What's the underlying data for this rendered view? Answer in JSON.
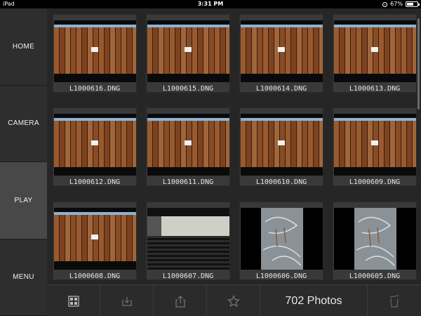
{
  "status_bar": {
    "device": "iPad",
    "time": "3:31 PM",
    "battery": "67%",
    "battery_level": 0.67
  },
  "nav": {
    "items": [
      {
        "label": "HOME",
        "active": false
      },
      {
        "label": "CAMERA",
        "active": false
      },
      {
        "label": "PLAY",
        "active": true
      },
      {
        "label": "MENU",
        "active": false
      }
    ]
  },
  "photos": [
    {
      "name": "L1000616.DNG",
      "kind": "fence"
    },
    {
      "name": "L1000615.DNG",
      "kind": "fence"
    },
    {
      "name": "L1000614.DNG",
      "kind": "fence"
    },
    {
      "name": "L1000613.DNG",
      "kind": "fence"
    },
    {
      "name": "L1000612.DNG",
      "kind": "fence"
    },
    {
      "name": "L1000611.DNG",
      "kind": "fence"
    },
    {
      "name": "L1000610.DNG",
      "kind": "fence"
    },
    {
      "name": "L1000609.DNG",
      "kind": "fence"
    },
    {
      "name": "L1000608.DNG",
      "kind": "fence"
    },
    {
      "name": "L1000607.DNG",
      "kind": "dark"
    },
    {
      "name": "L1000606.DNG",
      "kind": "glass"
    },
    {
      "name": "L1000605.DNG",
      "kind": "glass"
    }
  ],
  "toolbar": {
    "photo_count": "702 Photos",
    "icons": [
      "grid-view-icon",
      "download-icon",
      "share-icon",
      "favorite-star-icon",
      "delete-icon"
    ]
  },
  "colors": {
    "active_nav": "#484848",
    "sidebar": "#2e2e2e",
    "grid_bg": "#262626"
  }
}
